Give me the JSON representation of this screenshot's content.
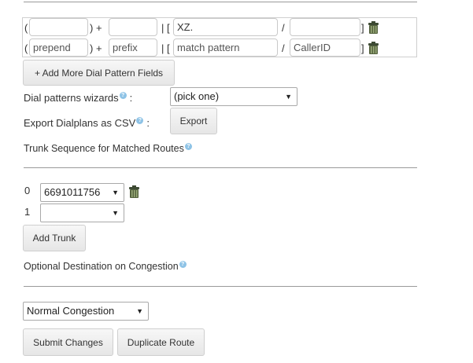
{
  "dial_patterns": {
    "rows": [
      {
        "prepend": "",
        "prefix": "",
        "match_pattern": "XZ.",
        "caller_id": ""
      },
      {
        "prepend": "",
        "prefix": "",
        "match_pattern": "",
        "caller_id": ""
      }
    ],
    "placeholders": {
      "prepend": "prepend",
      "prefix": "prefix",
      "match_pattern": "match pattern",
      "caller_id": "CallerID"
    },
    "sym_open_paren": "(",
    "sym_close_plus": ") +",
    "sym_pipe_bracket": "| [",
    "sym_slash": "/",
    "sym_close_bracket": "]",
    "add_more_label": "+ Add More Dial Pattern Fields"
  },
  "wizards": {
    "label": "Dial patterns wizards",
    "suffix": ":",
    "selected": "(pick one)"
  },
  "export": {
    "label": "Export Dialplans as CSV",
    "suffix": ":",
    "button": "Export"
  },
  "trunk_sequence": {
    "heading": "Trunk Sequence for Matched Routes",
    "rows": [
      {
        "index": "0",
        "selected": "6691011756"
      },
      {
        "index": "1",
        "selected": ""
      }
    ],
    "add_button": "Add Trunk"
  },
  "congestion": {
    "heading": "Optional Destination on Congestion",
    "selected": "Normal Congestion"
  },
  "actions": {
    "submit": "Submit Changes",
    "duplicate": "Duplicate Route"
  },
  "help_glyph": "?"
}
